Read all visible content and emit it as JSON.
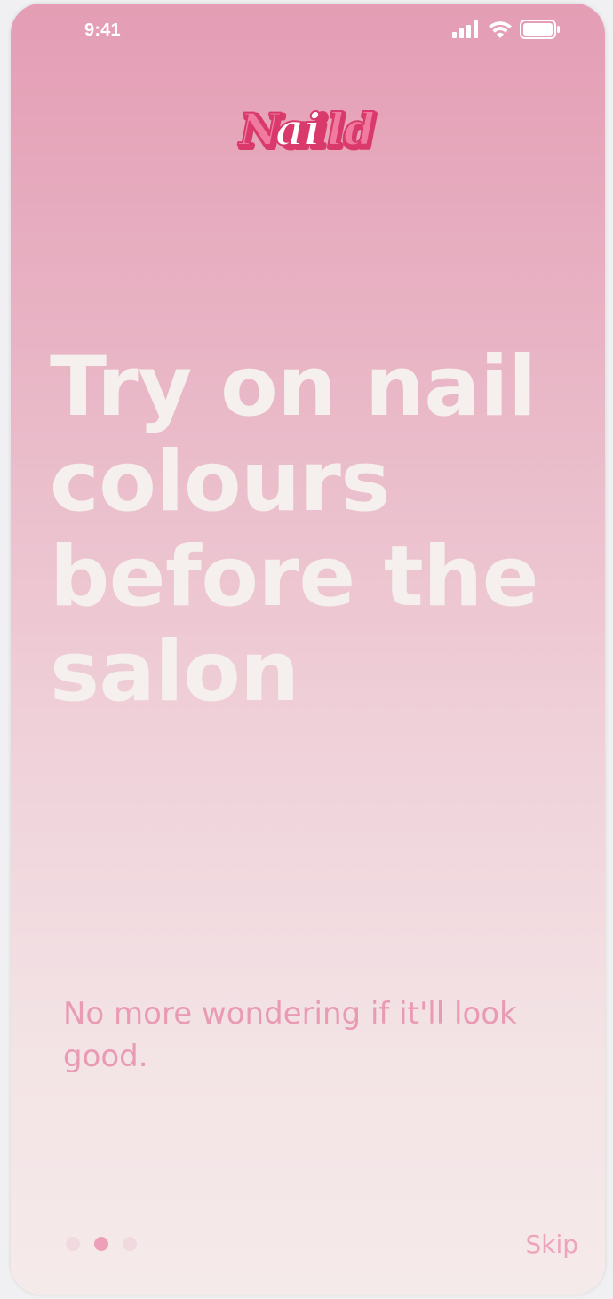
{
  "status_bar": {
    "time": "9:41",
    "icons": [
      "cellular-signal-icon",
      "wifi-icon",
      "battery-icon"
    ]
  },
  "brand": {
    "logo_text": "Naild",
    "logo_color": "#d93a6b",
    "logo_inner_color": "#ffffff"
  },
  "onboarding": {
    "headline": "Try on nail colours before the salon",
    "subtext": "No more wondering if it'll look good.",
    "page_count": 3,
    "active_page": 2,
    "skip_label": "Skip"
  },
  "colors": {
    "gradient_top": "#e49db4",
    "gradient_bottom": "#f5eaea",
    "headline": "#f5f0ee",
    "accent": "#e99bb5",
    "dot_active": "#ee9fba",
    "dot_inactive": "#f1d9e0"
  }
}
